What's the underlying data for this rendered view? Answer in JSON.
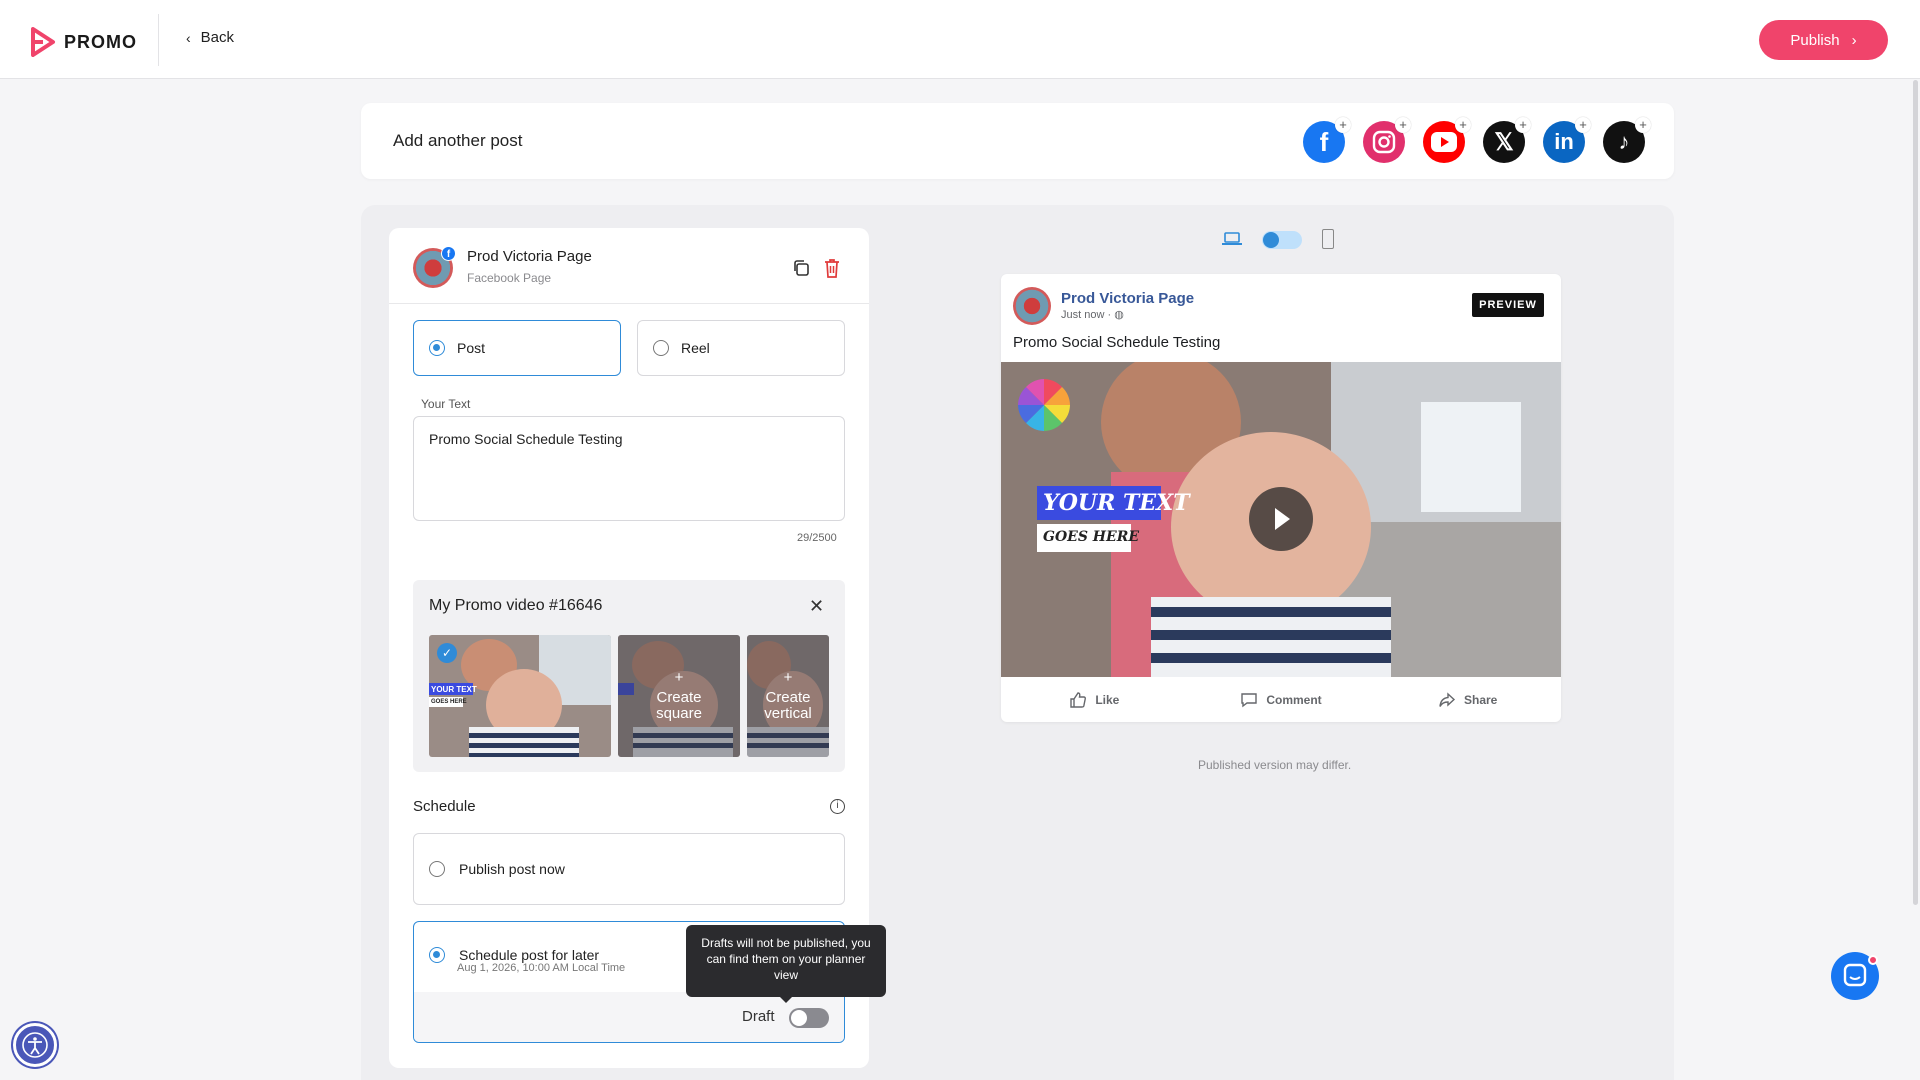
{
  "brand": {
    "name": "PROMO",
    "accent": "#f0446b"
  },
  "nav": {
    "back_label": "Back",
    "publish_label": "Publish"
  },
  "add_post": {
    "title": "Add another post",
    "networks": [
      "facebook-icon",
      "instagram-icon",
      "youtube-icon",
      "x-icon",
      "linkedin-icon",
      "tiktok-icon"
    ]
  },
  "account": {
    "name": "Prod Victoria Page",
    "type": "Facebook Page"
  },
  "post_types": {
    "post_label": "Post",
    "reel_label": "Reel",
    "selected": "Post"
  },
  "text_field": {
    "label": "Your Text",
    "value": "Promo Social Schedule Testing",
    "counter": "29/2500"
  },
  "video": {
    "title": "My Promo video #16646",
    "thumb_overlay_text": "YOUR TEXT",
    "thumb_overlay_sub": "GOES HERE",
    "square_label": "Create square",
    "vertical_label": "Create vertical",
    "plus": "+"
  },
  "schedule": {
    "label": "Schedule",
    "now_label": "Publish post now",
    "later_label": "Schedule post for later",
    "later_date": "Aug 1, 2026, 10:00 AM Local Time",
    "selected": "later",
    "draft_label": "Draft",
    "draft_on": false,
    "tooltip": "Drafts will not be published, you can find them on your planner view"
  },
  "preview": {
    "page_name": "Prod Victoria Page",
    "time": "Just now",
    "badge": "PREVIEW",
    "post_text": "Promo Social Schedule Testing",
    "video_text": "YOUR TEXT",
    "video_sub": "GOES HERE",
    "actions": {
      "like": "Like",
      "comment": "Comment",
      "share": "Share"
    },
    "disclaimer": "Published version may differ."
  }
}
